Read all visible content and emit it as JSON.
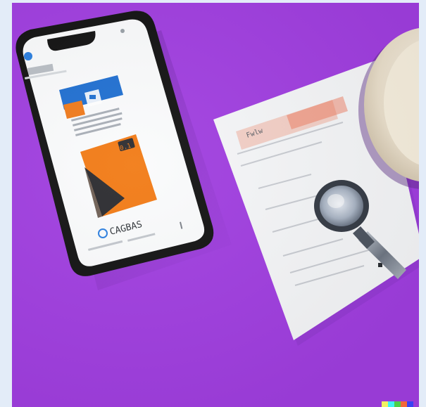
{
  "phone": {
    "card_badge_text": "0.1",
    "footer_text": "CAGBAS"
  },
  "document": {
    "header_text": "Fwlw"
  },
  "watermark": {
    "colors": [
      "#ffff66",
      "#42ffff",
      "#51da4c",
      "#ff6e3c",
      "#3c46ff"
    ]
  },
  "colors": {
    "background": "#a03ee0",
    "accent_blue": "#1f6fd1",
    "accent_orange": "#f07a1a"
  }
}
